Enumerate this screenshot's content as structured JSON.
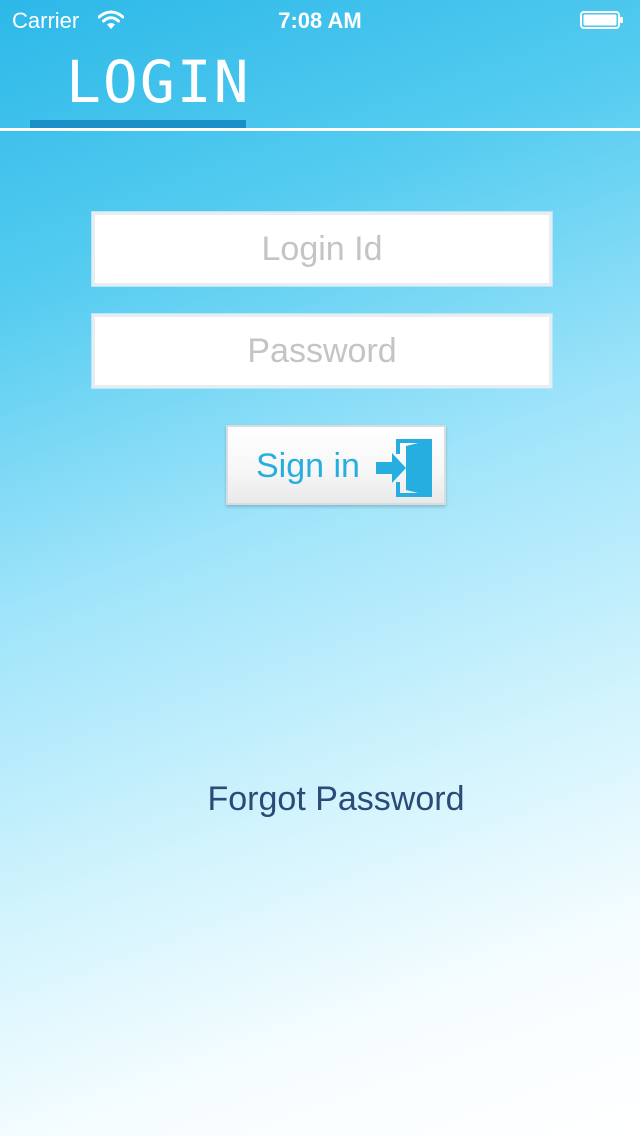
{
  "status_bar": {
    "carrier": "Carrier",
    "time": "7:08 AM",
    "wifi_icon": "wifi-icon",
    "battery_icon": "battery-icon"
  },
  "header": {
    "title": "LOGIN"
  },
  "form": {
    "login_id": {
      "value": "",
      "placeholder": "Login Id"
    },
    "password": {
      "value": "",
      "placeholder": "Password"
    },
    "sign_in": {
      "label": "Sign in",
      "icon": "sign-in-icon"
    },
    "forgot_password": "Forgot Password"
  },
  "colors": {
    "accent": "#27aee0",
    "tab_indicator": "#1a8ec7",
    "link": "#2a4a78"
  }
}
